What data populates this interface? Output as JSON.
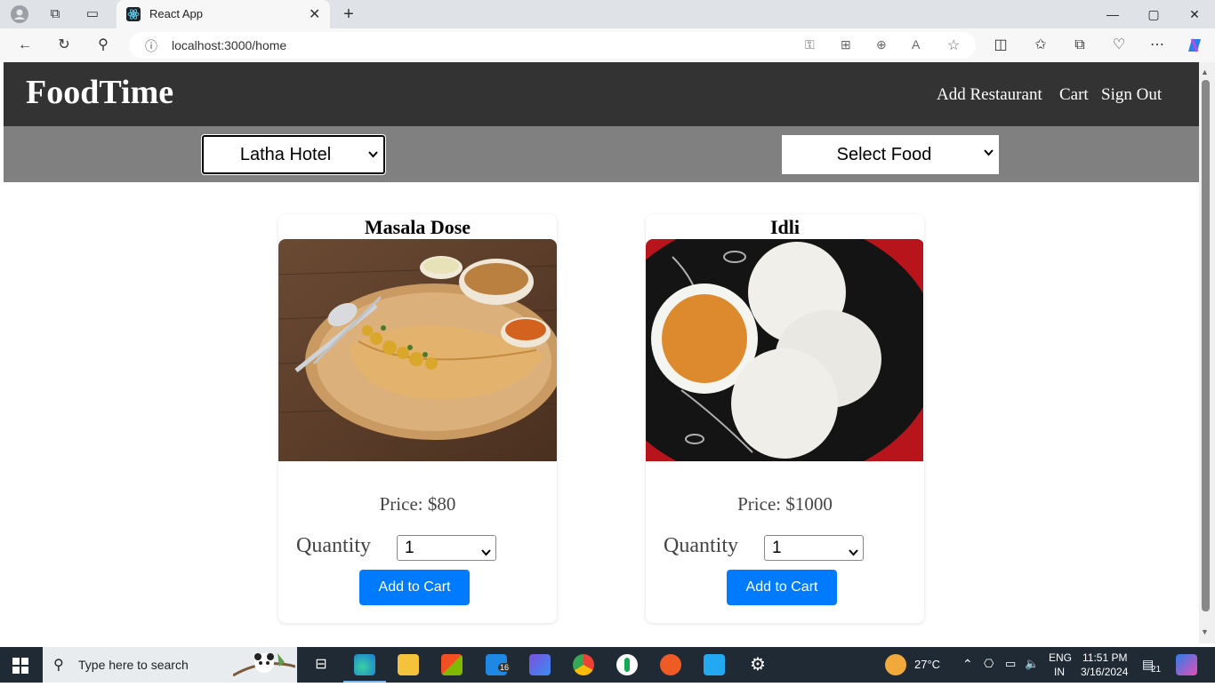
{
  "browser": {
    "tab_title": "React App",
    "tab_close": "✕",
    "new_tab": "+",
    "url": "localhost:3000/home",
    "window_buttons": [
      "—",
      "▢",
      "✕"
    ]
  },
  "app": {
    "logo": "FoodTime",
    "nav": [
      "Add Restaurant",
      "Cart",
      "Sign Out"
    ],
    "restaurant_select": "Latha Hotel",
    "food_select": "Select Food"
  },
  "cards": [
    {
      "title": "Masala Dose",
      "price": "Price: $80",
      "quantity_label": "Quantity",
      "quantity_value": "1",
      "button": "Add to Cart"
    },
    {
      "title": "Idli",
      "price": "Price: $1000",
      "quantity_label": "Quantity",
      "quantity_value": "1",
      "button": "Add to Cart"
    }
  ],
  "taskbar": {
    "search_placeholder": "Type here to search",
    "weather": "27°C",
    "lang": "ENG",
    "region": "IN",
    "time": "11:51 PM",
    "date": "3/16/2024",
    "notifications": "21",
    "edge_badge": "16"
  },
  "colors": {
    "header_bg": "#333333",
    "filter_bg": "#808080",
    "button_blue": "#007bff"
  }
}
